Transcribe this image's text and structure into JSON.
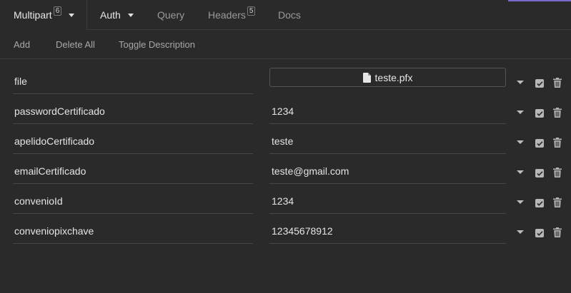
{
  "tabs": [
    {
      "label": "Multipart",
      "badge": "6",
      "has_caret": true,
      "active": true
    },
    {
      "label": "Auth",
      "has_caret": true
    },
    {
      "label": "Query"
    },
    {
      "label": "Headers",
      "badge": "5"
    },
    {
      "label": "Docs"
    }
  ],
  "toolbar": {
    "add": "Add",
    "delete_all": "Delete All",
    "toggle_description": "Toggle Description"
  },
  "params": [
    {
      "name": "file",
      "value": "teste.pfx",
      "type": "file",
      "enabled": true
    },
    {
      "name": "passwordCertificado",
      "value": "1234",
      "type": "text",
      "enabled": true
    },
    {
      "name": "apelidoCertificado",
      "value": "teste",
      "type": "text",
      "enabled": true
    },
    {
      "name": "emailCertificado",
      "value": "teste@gmail.com",
      "type": "text",
      "enabled": true
    },
    {
      "name": "convenioId",
      "value": "1234",
      "type": "text",
      "enabled": true
    },
    {
      "name": "conveniopixchave",
      "value": "12345678912",
      "type": "text",
      "enabled": true
    }
  ],
  "colors": {
    "background": "#2a2a2a",
    "accent": "#7d69cb",
    "border": "#474747"
  }
}
